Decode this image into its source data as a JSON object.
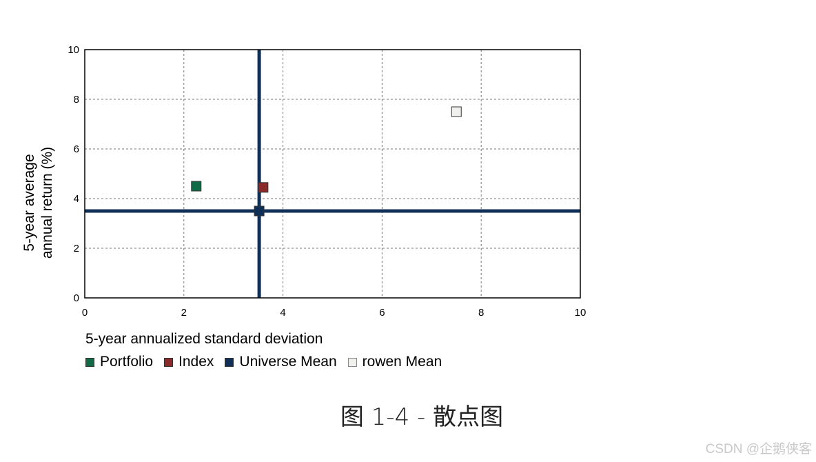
{
  "chart_data": {
    "type": "scatter",
    "xlabel": "5-year annualized standard deviation",
    "ylabel_lines": [
      "5-year average",
      "annual return (%)"
    ],
    "xlim": [
      0,
      10
    ],
    "ylim": [
      0,
      10
    ],
    "xticks": [
      0,
      2,
      4,
      6,
      8,
      10
    ],
    "yticks": [
      0,
      2,
      4,
      6,
      8,
      10
    ],
    "grid": true,
    "legend_position": "bottom-left",
    "series": [
      {
        "name": "Portfolio",
        "color": "#0e6b45",
        "points": [
          {
            "x": 2.25,
            "y": 4.5
          }
        ]
      },
      {
        "name": "Index",
        "color": "#8b2a2a",
        "points": [
          {
            "x": 3.6,
            "y": 4.45
          }
        ]
      },
      {
        "name": "Universe Mean",
        "color": "#0f2f57",
        "points": [
          {
            "x": 3.52,
            "y": 3.5
          }
        ],
        "crosshair": true
      },
      {
        "name": "rowen Mean",
        "color": "#f0f0ee",
        "points": [
          {
            "x": 7.5,
            "y": 7.5
          }
        ]
      }
    ]
  },
  "caption": "图 1-4 - 散点图",
  "watermark": "CSDN @企鹅侠客"
}
